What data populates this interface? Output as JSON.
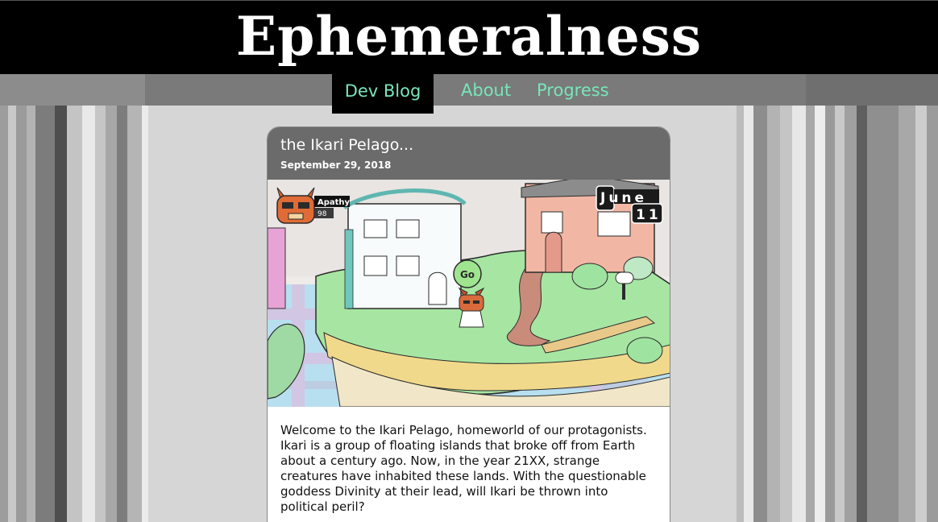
{
  "site": {
    "title": "Ephemeralness"
  },
  "nav": {
    "items": [
      {
        "label": "Dev Blog",
        "active": true
      },
      {
        "label": "About",
        "active": false
      },
      {
        "label": "Progress",
        "active": false
      }
    ],
    "link_color": "#78e6b9"
  },
  "post": {
    "title": "the Ikari Pelago...",
    "date": "September 29, 2018",
    "image": {
      "hud_character_name": "Apathy",
      "hud_character_value": "98",
      "calendar_month": "June",
      "calendar_day": "11",
      "bubble_text": "Go"
    },
    "body": "Welcome to the Ikari Pelago, homeworld of our protagonists. Ikari is a group of floating islands that broke off from Earth about a century ago. Now, in the year 21XX, strange creatures have inhabited these lands. With the questionable goddess Divinity at their lead, will Ikari be thrown into political peril?"
  }
}
